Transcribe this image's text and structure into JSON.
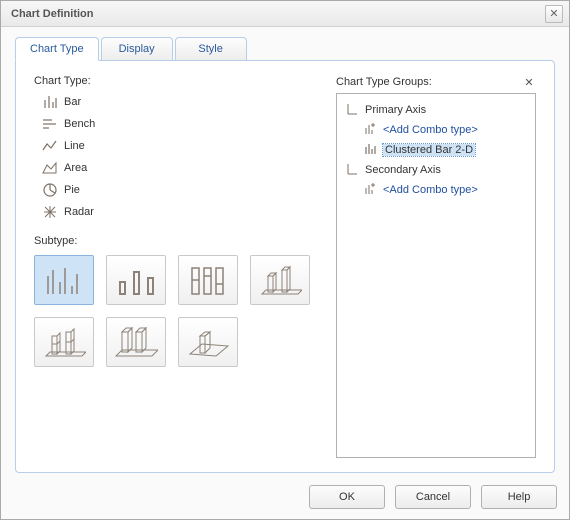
{
  "dialog": {
    "title": "Chart Definition",
    "close_glyph": "✕"
  },
  "tabs": [
    {
      "label": "Chart Type",
      "active": true
    },
    {
      "label": "Display",
      "active": false
    },
    {
      "label": "Style",
      "active": false
    }
  ],
  "chart_type": {
    "section_label": "Chart Type:",
    "items": [
      {
        "label": "Bar",
        "icon": "bar-icon"
      },
      {
        "label": "Bench",
        "icon": "bench-icon"
      },
      {
        "label": "Line",
        "icon": "line-icon"
      },
      {
        "label": "Area",
        "icon": "area-icon"
      },
      {
        "label": "Pie",
        "icon": "pie-icon"
      },
      {
        "label": "Radar",
        "icon": "radar-icon"
      }
    ]
  },
  "subtype": {
    "section_label": "Subtype:",
    "items": [
      {
        "name": "clustered-bar-2d",
        "selected": true
      },
      {
        "name": "clustered-bar-gap",
        "selected": false
      },
      {
        "name": "stacked-bar-2d",
        "selected": false
      },
      {
        "name": "clustered-bar-3d",
        "selected": false
      },
      {
        "name": "clustered-bar-cyl",
        "selected": false
      },
      {
        "name": "stacked-bar-3d",
        "selected": false
      },
      {
        "name": "bar-3d-perspective",
        "selected": false
      }
    ]
  },
  "groups": {
    "section_label": "Chart Type Groups:",
    "close_glyph": "✕",
    "tree": {
      "primary_axis_label": "Primary Axis",
      "primary_add_label": "<Add Combo type>",
      "primary_item_label": "Clustered Bar 2-D",
      "secondary_axis_label": "Secondary Axis",
      "secondary_add_label": "<Add Combo type>"
    }
  },
  "footer": {
    "ok": "OK",
    "cancel": "Cancel",
    "help": "Help"
  }
}
